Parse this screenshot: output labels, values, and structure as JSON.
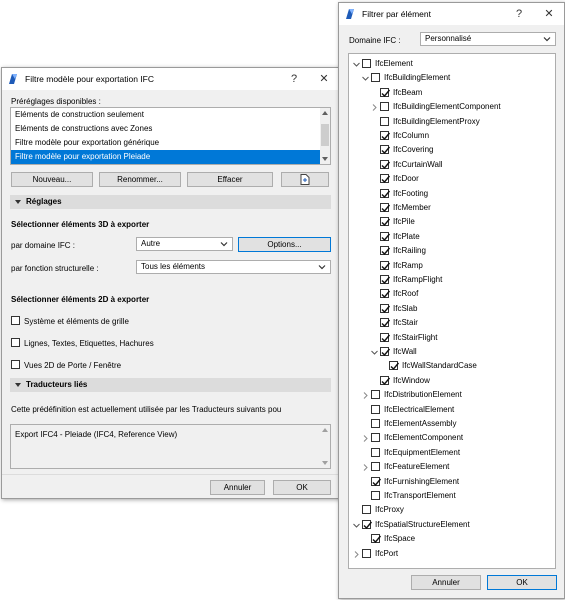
{
  "left_dialog": {
    "title": "Filtre modèle pour exportation IFC",
    "help_button": "?",
    "close_button": "✕",
    "presets_label": "Préréglages disponibles :",
    "presets": [
      {
        "label": "Eléments de construction seulement",
        "selected": false
      },
      {
        "label": "Eléments de constructions avec Zones",
        "selected": false
      },
      {
        "label": "Filtre modèle pour exportation générique",
        "selected": false
      },
      {
        "label": "Filtre modèle pour exportation Pleiade",
        "selected": true
      }
    ],
    "buttons": {
      "new": "Nouveau...",
      "rename": "Renommer...",
      "delete": "Effacer"
    },
    "settings_header": "Réglages",
    "select_3d_label": "Sélectionner éléments 3D à exporter",
    "by_ifc_domain_label": "par domaine IFC :",
    "by_ifc_domain_value": "Autre",
    "options_button": "Options...",
    "by_structural_label": "par fonction structurelle :",
    "by_structural_value": "Tous les éléments",
    "select_2d_label": "Sélectionner éléments 2D à exporter",
    "checkboxes_2d": [
      {
        "label": "Système et éléments de grille",
        "checked": false
      },
      {
        "label": "Lignes, Textes, Etiquettes, Hachures",
        "checked": false
      },
      {
        "label": "Vues 2D de Porte / Fenêtre",
        "checked": false
      }
    ],
    "translators_header": "Traducteurs liés",
    "translators_info": "Cette prédéfinition est actuellement utilisée par les Traducteurs suivants pou",
    "translators_list": [
      "Export IFC4 - Pleiade (IFC4, Reference View)"
    ],
    "cancel_button": "Annuler",
    "ok_button": "OK"
  },
  "right_dialog": {
    "title": "Filtrer par élément",
    "help_button": "?",
    "close_button": "✕",
    "domain_label": "Domaine IFC :",
    "domain_value": "Personnalisé",
    "tree": [
      {
        "label": "IfcElement",
        "level": 0,
        "expander": "expanded",
        "checked": false
      },
      {
        "label": "IfcBuildingElement",
        "level": 1,
        "expander": "expanded",
        "checked": false
      },
      {
        "label": "IfcBeam",
        "level": 2,
        "expander": "none",
        "checked": true
      },
      {
        "label": "IfcBuildingElementComponent",
        "level": 2,
        "expander": "collapsed",
        "checked": false
      },
      {
        "label": "IfcBuildingElementProxy",
        "level": 2,
        "expander": "none",
        "checked": false
      },
      {
        "label": "IfcColumn",
        "level": 2,
        "expander": "none",
        "checked": true
      },
      {
        "label": "IfcCovering",
        "level": 2,
        "expander": "none",
        "checked": true
      },
      {
        "label": "IfcCurtainWall",
        "level": 2,
        "expander": "none",
        "checked": true
      },
      {
        "label": "IfcDoor",
        "level": 2,
        "expander": "none",
        "checked": true
      },
      {
        "label": "IfcFooting",
        "level": 2,
        "expander": "none",
        "checked": true
      },
      {
        "label": "IfcMember",
        "level": 2,
        "expander": "none",
        "checked": true
      },
      {
        "label": "IfcPile",
        "level": 2,
        "expander": "none",
        "checked": true
      },
      {
        "label": "IfcPlate",
        "level": 2,
        "expander": "none",
        "checked": true
      },
      {
        "label": "IfcRailing",
        "level": 2,
        "expander": "none",
        "checked": true
      },
      {
        "label": "IfcRamp",
        "level": 2,
        "expander": "none",
        "checked": true
      },
      {
        "label": "IfcRampFlight",
        "level": 2,
        "expander": "none",
        "checked": true
      },
      {
        "label": "IfcRoof",
        "level": 2,
        "expander": "none",
        "checked": true
      },
      {
        "label": "IfcSlab",
        "level": 2,
        "expander": "none",
        "checked": true
      },
      {
        "label": "IfcStair",
        "level": 2,
        "expander": "none",
        "checked": true
      },
      {
        "label": "IfcStairFlight",
        "level": 2,
        "expander": "none",
        "checked": true
      },
      {
        "label": "IfcWall",
        "level": 2,
        "expander": "expanded",
        "checked": true
      },
      {
        "label": "IfcWallStandardCase",
        "level": 3,
        "expander": "none",
        "checked": true
      },
      {
        "label": "IfcWindow",
        "level": 2,
        "expander": "none",
        "checked": true
      },
      {
        "label": "IfcDistributionElement",
        "level": 1,
        "expander": "collapsed",
        "checked": false
      },
      {
        "label": "IfcElectricalElement",
        "level": 1,
        "expander": "none",
        "checked": false
      },
      {
        "label": "IfcElementAssembly",
        "level": 1,
        "expander": "none",
        "checked": false
      },
      {
        "label": "IfcElementComponent",
        "level": 1,
        "expander": "collapsed",
        "checked": false
      },
      {
        "label": "IfcEquipmentElement",
        "level": 1,
        "expander": "none",
        "checked": false
      },
      {
        "label": "IfcFeatureElement",
        "level": 1,
        "expander": "collapsed",
        "checked": false
      },
      {
        "label": "IfcFurnishingElement",
        "level": 1,
        "expander": "none",
        "checked": true
      },
      {
        "label": "IfcTransportElement",
        "level": 1,
        "expander": "none",
        "checked": false
      },
      {
        "label": "IfcProxy",
        "level": 0,
        "expander": "none",
        "checked": false
      },
      {
        "label": "IfcSpatialStructureElement",
        "level": 0,
        "expander": "expanded",
        "checked": true
      },
      {
        "label": "IfcSpace",
        "level": 1,
        "expander": "none",
        "checked": true
      },
      {
        "label": "IfcPort",
        "level": 0,
        "expander": "collapsed",
        "checked": false
      }
    ],
    "cancel_button": "Annuler",
    "ok_button": "OK"
  },
  "colors": {
    "selection": "#0078d7",
    "dialog_bg": "#f0f0f0",
    "section_bg": "#dcdcdc"
  }
}
